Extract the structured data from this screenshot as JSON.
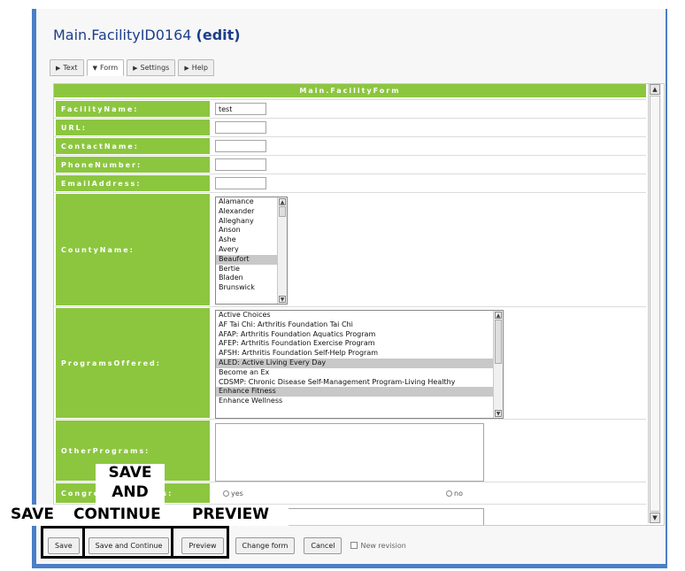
{
  "page": {
    "title_name": "Main.FacilityID0164",
    "title_mode": "(edit)"
  },
  "tabs": [
    {
      "label": "Text",
      "active": false
    },
    {
      "label": "Form",
      "active": true
    },
    {
      "label": "Settings",
      "active": false
    },
    {
      "label": "Help",
      "active": false
    }
  ],
  "form": {
    "header": "Main.FacilityForm",
    "fields": {
      "facility_name": {
        "label": "FacilityName:",
        "value": "test"
      },
      "url": {
        "label": "URL:",
        "value": ""
      },
      "contact_name": {
        "label": "ContactName:",
        "value": ""
      },
      "phone_number": {
        "label": "PhoneNumber:",
        "value": ""
      },
      "email_address": {
        "label": "EmailAddress:",
        "value": ""
      },
      "county_name": {
        "label": "CountyName:",
        "options": [
          "Alamance",
          "Alexander",
          "Alleghany",
          "Anson",
          "Ashe",
          "Avery",
          "Beaufort",
          "Bertie",
          "Bladen",
          "Brunswick"
        ],
        "selected": "Beaufort"
      },
      "programs_offered": {
        "label": "ProgramsOffered:",
        "options": [
          "Active Choices",
          "AF Tai Chi: Arthritis Foundation Tai Chi",
          "AFAP: Arthritis Foundation Aquatics Program",
          "AFEP: Arthritis Foundation Exercise Program",
          "AFSH: Arthritis Foundation Self-Help Program",
          "ALED: Active Living Every Day",
          "Become an Ex",
          "CDSMP: Chronic Disease Self-Management Program-Living Healthy",
          "Enhance Fitness",
          "Enhance Wellness"
        ],
        "selected": [
          "ALED: Active Living Every Day",
          "Enhance Fitness"
        ]
      },
      "other_programs": {
        "label": "OtherPrograms:",
        "value": ""
      },
      "congregate_meals": {
        "label": "Congre",
        "label_tail": "als:",
        "option_yes": "yes",
        "option_no": "no"
      }
    }
  },
  "buttons": {
    "save": "Save",
    "save_continue": "Save and Continue",
    "preview": "Preview",
    "change_form": "Change form",
    "cancel": "Cancel",
    "new_revision": "New revision"
  },
  "annotations": {
    "save_and_line1": "SAVE",
    "save_and_line2": "AND",
    "save": "SAVE",
    "continue": "CONTINUE",
    "preview": "PREVIEW"
  },
  "colors": {
    "frame_blue": "#4a7fc6",
    "label_green": "#8cc63f",
    "title_blue": "#1d3f8a"
  }
}
